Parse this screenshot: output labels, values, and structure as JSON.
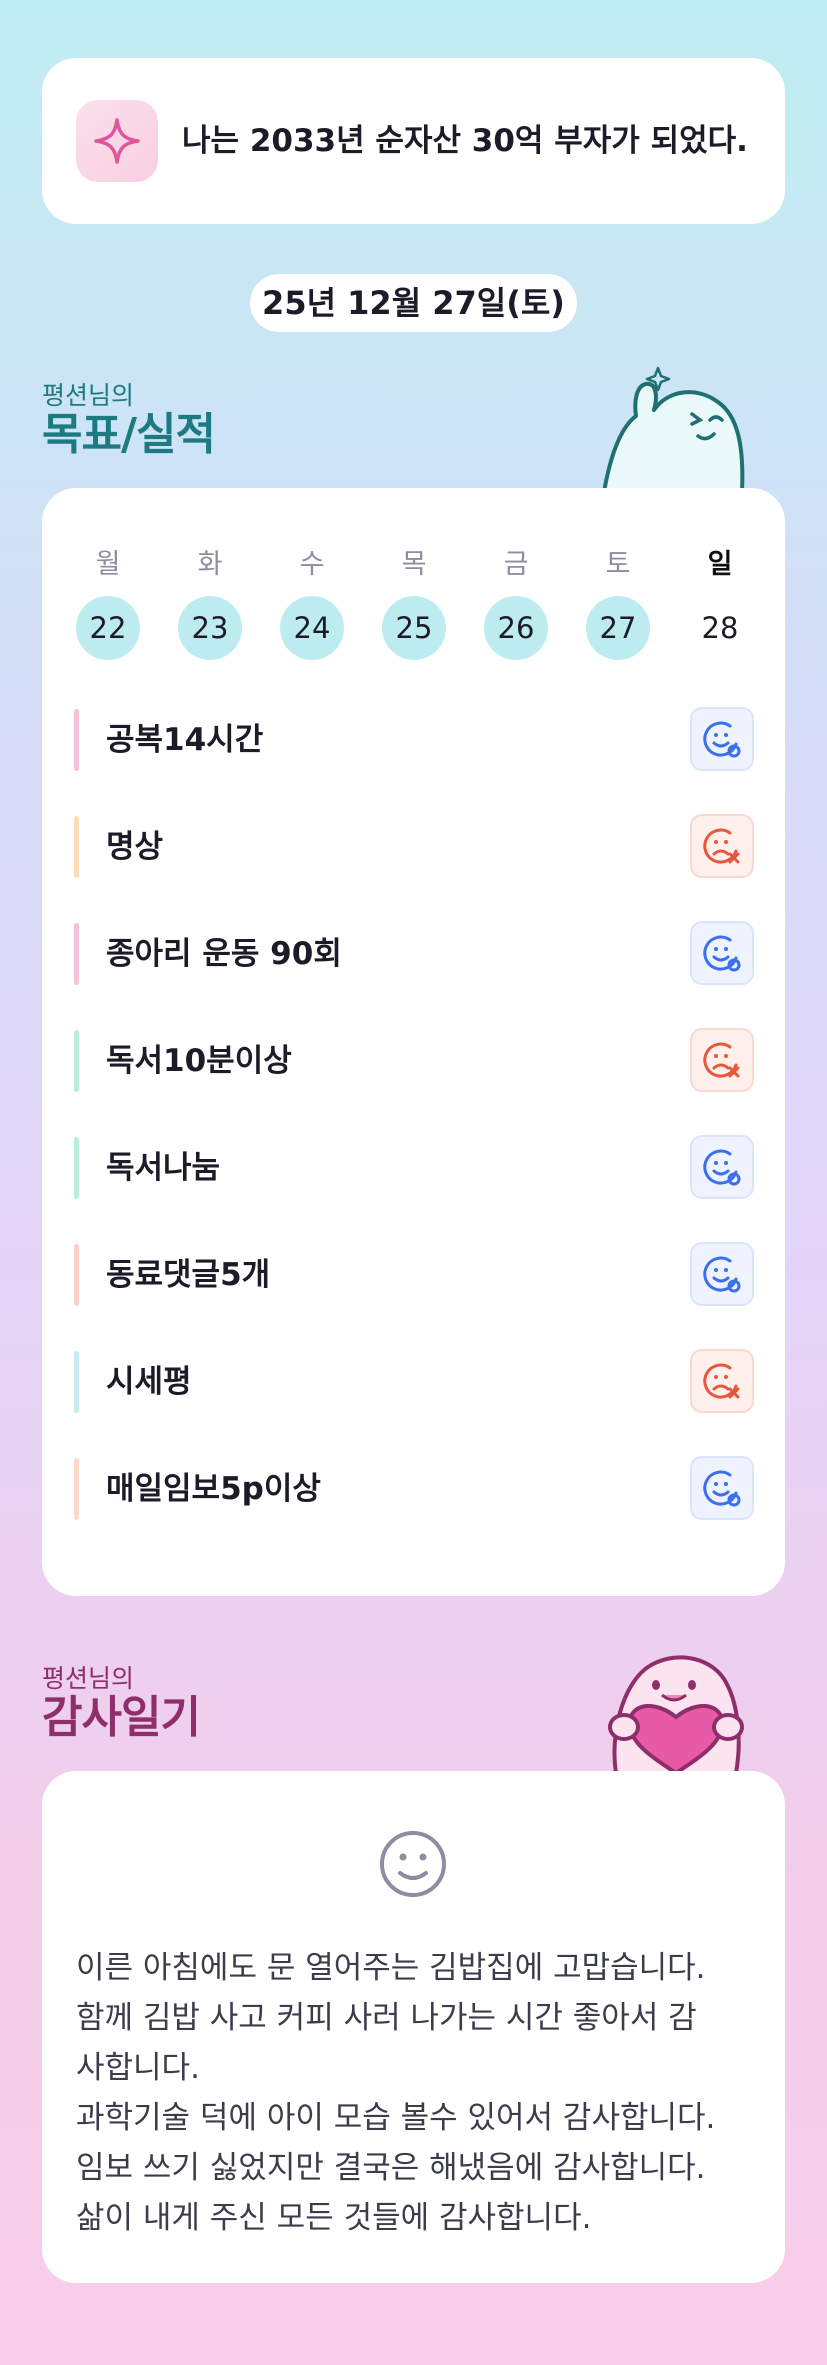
{
  "goal": {
    "text": "나는 2033년 순자산 30억 부자가 되었다.",
    "icon": "sparkle-icon"
  },
  "date": "25년 12월 27일(토)",
  "tracker": {
    "subtitle": "평션님의",
    "title": "목표/실적",
    "days": [
      {
        "label": "월",
        "num": "22",
        "done": true
      },
      {
        "label": "화",
        "num": "23",
        "done": true
      },
      {
        "label": "수",
        "num": "24",
        "done": true
      },
      {
        "label": "목",
        "num": "25",
        "done": true
      },
      {
        "label": "금",
        "num": "26",
        "done": true
      },
      {
        "label": "토",
        "num": "27",
        "done": true
      },
      {
        "label": "일",
        "num": "28",
        "done": false
      }
    ],
    "tasks": [
      {
        "label": "공복14시간",
        "status": "achieved",
        "bar_color": "#f6c2d8"
      },
      {
        "label": "명상",
        "status": "failed",
        "bar_color": "#fbdcb6"
      },
      {
        "label": "종아리 운동 90회",
        "status": "achieved",
        "bar_color": "#f6c2d8"
      },
      {
        "label": "독서10분이상",
        "status": "failed",
        "bar_color": "#b9ecd9"
      },
      {
        "label": "독서나눔",
        "status": "achieved",
        "bar_color": "#b9ecd9"
      },
      {
        "label": "동료댓글5개",
        "status": "achieved",
        "bar_color": "#fbd0cb"
      },
      {
        "label": "시세평",
        "status": "failed",
        "bar_color": "#c4eef0"
      },
      {
        "label": "매일임보5p이상",
        "status": "achieved",
        "bar_color": "#fbd7cf"
      }
    ]
  },
  "diary": {
    "subtitle": "평션님의",
    "title": "감사일기",
    "icon": "smiley-icon",
    "text": "이른 아침에도 문 열어주는 김밥집에 고맙습니다.\n함께 김밥 사고 커피 사러 나가는 시간 좋아서 감\n사합니다.\n과학기술 덕에 아이 모습 볼수 있어서 감사합니다.\n임보 쓰기 싫었지만 결국은 해냈음에 감사합니다.\n삶이 내게 주신 모든 것들에 감사합니다."
  },
  "colors": {
    "accent_teal": "#1d7a80",
    "accent_plum": "#8e2e6a",
    "achieved_blue": "#3a6ff0",
    "failed_red": "#e8563e",
    "day_done_bg": "#bcecef"
  }
}
